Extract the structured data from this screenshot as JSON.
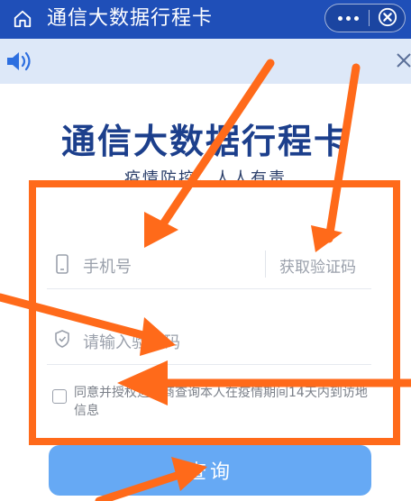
{
  "header": {
    "title": "通信大数据行程卡"
  },
  "page": {
    "big_title": "通信大数据行程卡",
    "subtitle": "疫情防控，人人有责"
  },
  "form": {
    "phone_placeholder": "手机号",
    "code_placeholder": "请输入验证码",
    "get_code_label": "获取验证码",
    "agree_text": "同意并授权运营商查询本人在疫情期间14天内到访地信息",
    "query_label": "查询"
  },
  "colors": {
    "header": "#1f4fb8",
    "notice": "#dde8f8",
    "title": "#1c3f8c",
    "button": "#66a9f4",
    "annotation": "#ff6a1a"
  },
  "icons": [
    "home-icon",
    "more-icon",
    "close-circle-icon",
    "speaker-icon",
    "close-icon",
    "phone-icon",
    "shield-icon"
  ]
}
